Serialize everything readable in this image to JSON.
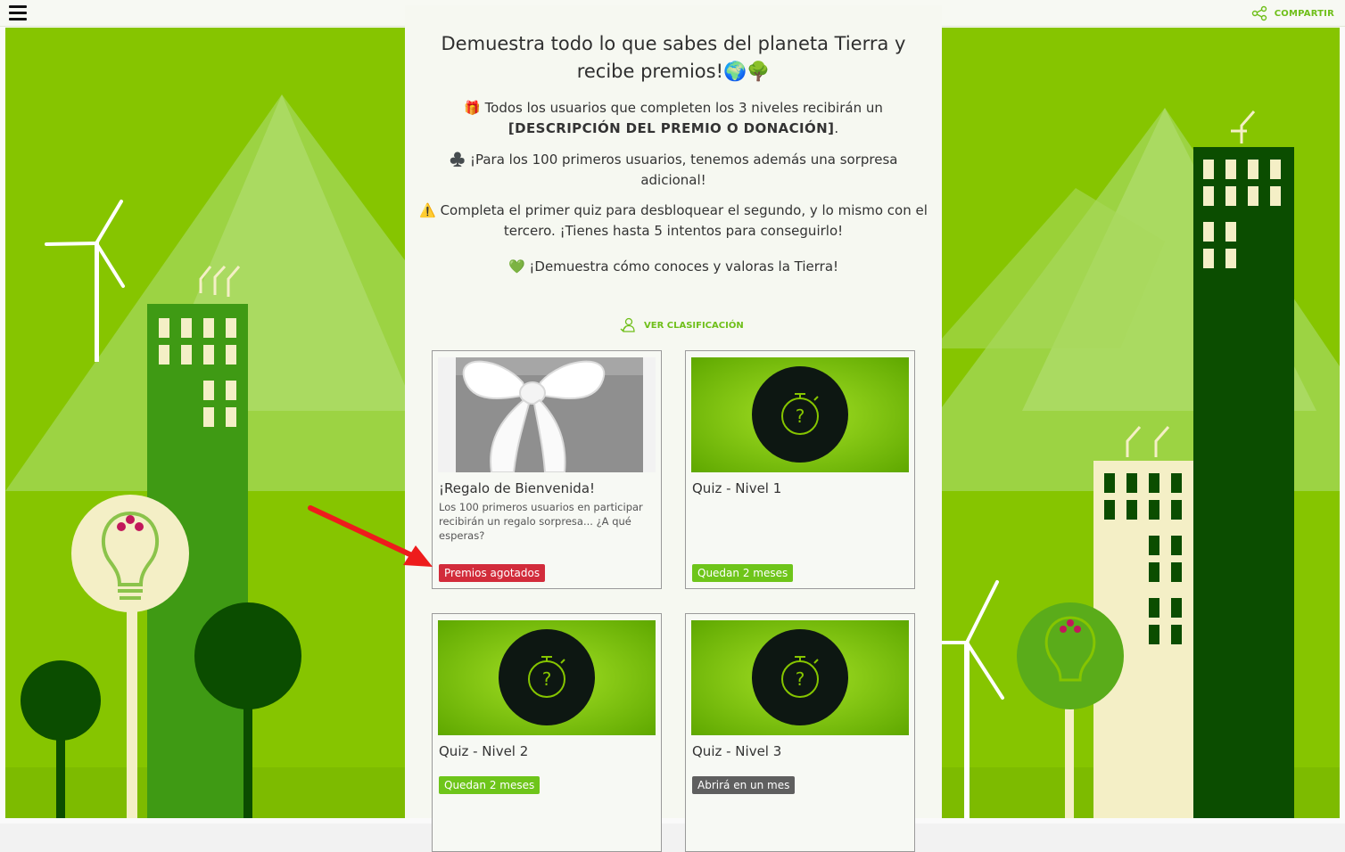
{
  "header": {
    "menu_icon": "hamburger-menu-icon",
    "share_label": "COMPARTIR",
    "share_icon": "share-icon"
  },
  "intro": {
    "title": "Demuestra todo lo que sabes del planeta Tierra y recibe premios!🌍🌳",
    "p1_pre": "🎁 Todos los usuarios que completen los 3 niveles recibirán un ",
    "p1_bold": "[DESCRIPCIÓN DEL PREMIO O DONACIÓN]",
    "p1_post": ".",
    "p2": "♣️ ¡Para los 100 primeros usuarios, tenemos además una sorpresa adicional!",
    "p3": "⚠️ Completa el primer quiz para desbloquear el segundo, y lo mismo con el tercero. ¡Tienes hasta 5 intentos para conseguirlo!",
    "p4": "💚 ¡Demuestra cómo conoces y valoras la Tierra!"
  },
  "ranking": {
    "label": "VER CLASIFICACIÓN",
    "icon": "leaderboard-icon"
  },
  "cards": [
    {
      "title": "¡Regalo de Bienvenida!",
      "description": "Los 100 primeros usuarios en participar recibirán un regalo sorpresa... ¿A qué esperas?",
      "badge": "Premios agotados",
      "badge_color": "#d22c3b",
      "image": "gift-box-image"
    },
    {
      "title": "Quiz - Nivel 1",
      "description": "",
      "badge": "Quedan 2 meses",
      "badge_color": "#6ec51a",
      "image": "quiz-stopwatch-icon"
    },
    {
      "title": "Quiz - Nivel 2",
      "description": "",
      "badge": "Quedan 2 meses",
      "badge_color": "#6ec51a",
      "image": "quiz-stopwatch-icon"
    },
    {
      "title": "Quiz - Nivel 3",
      "description": "",
      "badge": "Abrirá en un mes",
      "badge_color": "#5f5f5f",
      "image": "quiz-stopwatch-icon"
    }
  ],
  "colors": {
    "accent": "#6fbf1a",
    "background_green": "#86c500",
    "dark_green": "#0b4d00"
  }
}
